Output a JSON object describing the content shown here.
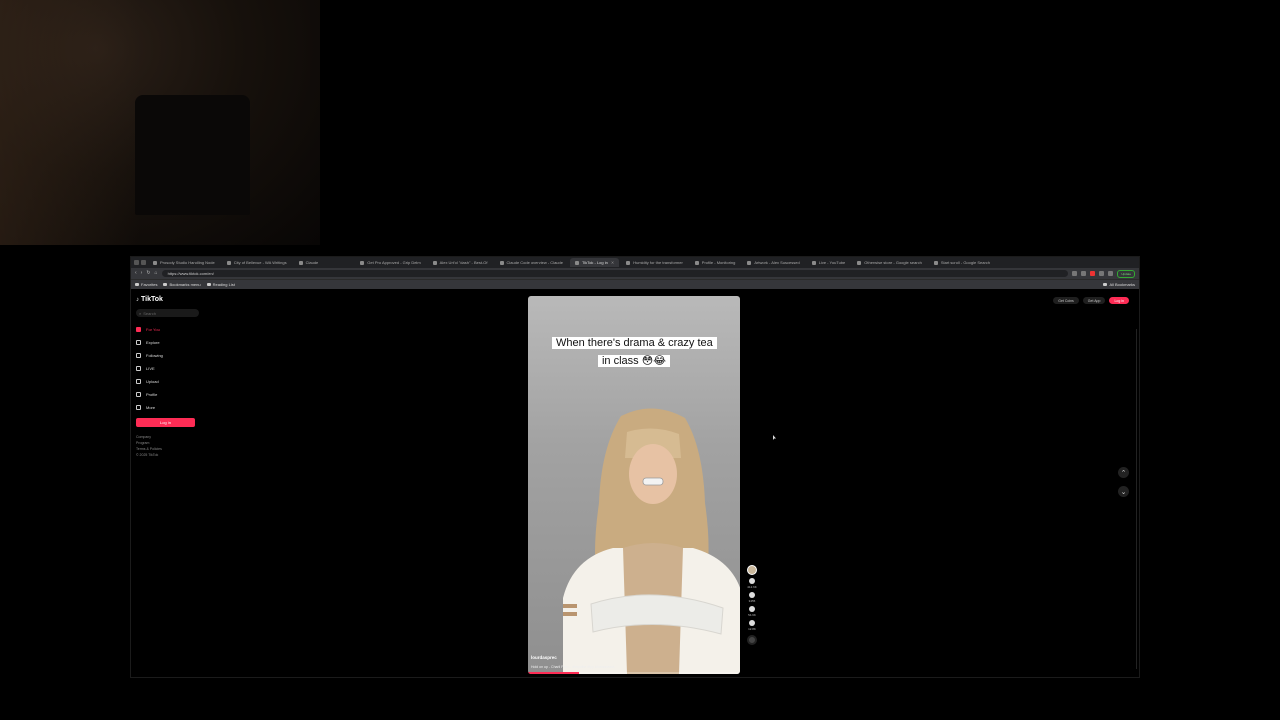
{
  "browser": {
    "tabs": [
      {
        "label": "Prosody Studio Handling Node"
      },
      {
        "label": "City of Bellevue - WA Writings"
      },
      {
        "label": "Claude"
      },
      {
        "label": "Get Pro Approved - Grip Delm"
      },
      {
        "label": "Alex Urt'ol \"dash\" - Best-Of"
      },
      {
        "label": "Claude Code overview - Claude"
      },
      {
        "label": "TikTok - Log in",
        "active": true
      },
      {
        "label": "Humidity for the transformer"
      },
      {
        "label": "Profile - Monitoring"
      },
      {
        "label": "Artwork - Alex Suscessed"
      },
      {
        "label": "Live - YouTube"
      },
      {
        "label": "Otherwise store - Google search"
      },
      {
        "label": "Start scroll - Google Search"
      }
    ],
    "url": "https://www.tiktok.com/en/",
    "sync_label": "Update",
    "bookmarks": [
      {
        "label": "Favorites"
      },
      {
        "label": "Bookmarks menu"
      },
      {
        "label": "Reading List"
      }
    ],
    "all_bookmarks": "All Bookmarks"
  },
  "tiktok": {
    "logo": "TikTok",
    "search_placeholder": "Search",
    "nav": [
      {
        "label": "For You",
        "active": true
      },
      {
        "label": "Explore"
      },
      {
        "label": "Following"
      },
      {
        "label": "LIVE"
      },
      {
        "label": "Upload"
      },
      {
        "label": "Profile"
      },
      {
        "label": "More"
      }
    ],
    "login_button": "Log in",
    "footer": [
      "Company",
      "Program",
      "Terms & Policies",
      "© 2025 TikTok"
    ],
    "topright": {
      "get_coins": "Get Coins",
      "get_app": "Get App",
      "login": "Log in"
    },
    "video": {
      "caption": "When there's drama & crazy tea in class 😳😂",
      "username": "lourdasprec",
      "description": "Hold on up - Charli Ferri... #heyvibe #fyp #humorreact",
      "progress": 0.24
    },
    "actions": {
      "likes": "412.6K",
      "comments": "3455",
      "saves": "54.6K",
      "shares": "12.8K"
    }
  }
}
